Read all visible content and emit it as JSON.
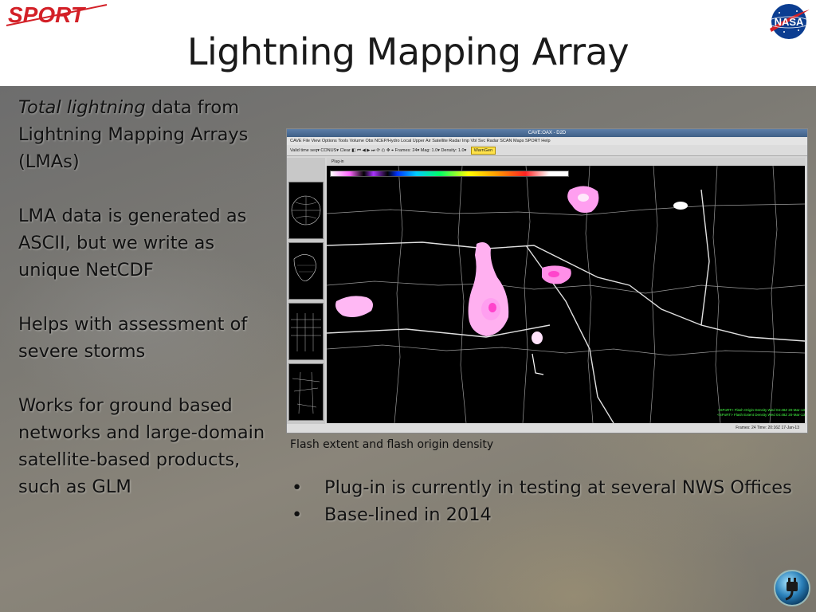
{
  "header": {
    "logo_left_text": "SPORT",
    "logo_right_text": "NASA",
    "title": "Lightning Mapping Array"
  },
  "left_column": {
    "paragraph1_italic": "Total lightning",
    "paragraph1_rest": " data from Lightning Mapping Arrays (LMAs)",
    "paragraph2": "LMA data is generated as ASCII, but we write as unique NetCDF",
    "paragraph3": "Helps with assessment of severe storms",
    "paragraph4": "Works for ground based networks and large-domain satellite-based products, such as GLM"
  },
  "screenshot": {
    "window_title": "CAVE:OAX - D2D",
    "menu_items": "CAVE  File  View  Options  Tools  Volume  Obs  NCEP/Hydro  Local  Upper Air  Satellite  Radar  Imp  Vbl  Svc  Radar  SCAN  Maps  SPORT  Help",
    "toolbar_text": "Valid time seq▾  CONUS▾  Clear  ◧  ⏮ ◀ ▶ ⏭ ⟳  ◴  ✥  ⌖   Frames: 24▾  Mag: 1.0▾  Density: 1.0▾",
    "warngen_label": "WarnGen",
    "map_tab": "Plug-in",
    "legend_line1": "<SPoRT> Flash Origin Density  Wed 04:48Z 20-Mar-13",
    "legend_line2": "<SPoRT> Flash Extent Density  Wed 04:48Z 20-Mar-13",
    "status_text": "Frames: 24   Time: 20:16Z 17-Jan-13"
  },
  "caption": "Flash extent and flash origin density",
  "bullets": [
    "Plug-in is currently in testing at several NWS Offices",
    "Base-lined in 2014"
  ],
  "bullet_symbol": "•",
  "icons": {
    "plug_icon": "plug-icon",
    "nasa_icon": "nasa-meatball-icon"
  },
  "colors": {
    "sport_red": "#d32027",
    "nasa_blue": "#0b3d91",
    "storm_pink": "#ff66dd"
  }
}
